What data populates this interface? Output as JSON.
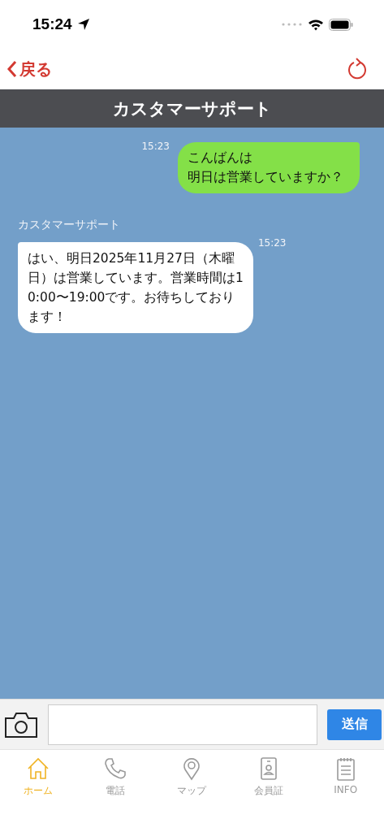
{
  "status_bar": {
    "time": "15:24"
  },
  "nav": {
    "back": "戻る"
  },
  "title": "カスタマーサポート",
  "messages": [
    {
      "kind": "sent",
      "time": "15:23",
      "lines": [
        "こんばんは",
        "明日は営業していますか？"
      ]
    },
    {
      "kind": "received",
      "sender": "カスタマーサポート",
      "time": "15:23",
      "lines": [
        "はい、明日2025年11月27日（木曜",
        "日）は営業しています。営業時間は1",
        "0:00〜19:00です。お待ちしており",
        "ます！"
      ]
    }
  ],
  "composer": {
    "send": "送信"
  },
  "tabs": [
    {
      "label": "ホーム",
      "kind": "home",
      "selected": true
    },
    {
      "label": "電話",
      "kind": "phone",
      "selected": false
    },
    {
      "label": "マップ",
      "kind": "pin",
      "selected": false
    },
    {
      "label": "会員証",
      "kind": "card",
      "selected": false
    },
    {
      "label": "INFO",
      "kind": "notes",
      "selected": false
    }
  ]
}
